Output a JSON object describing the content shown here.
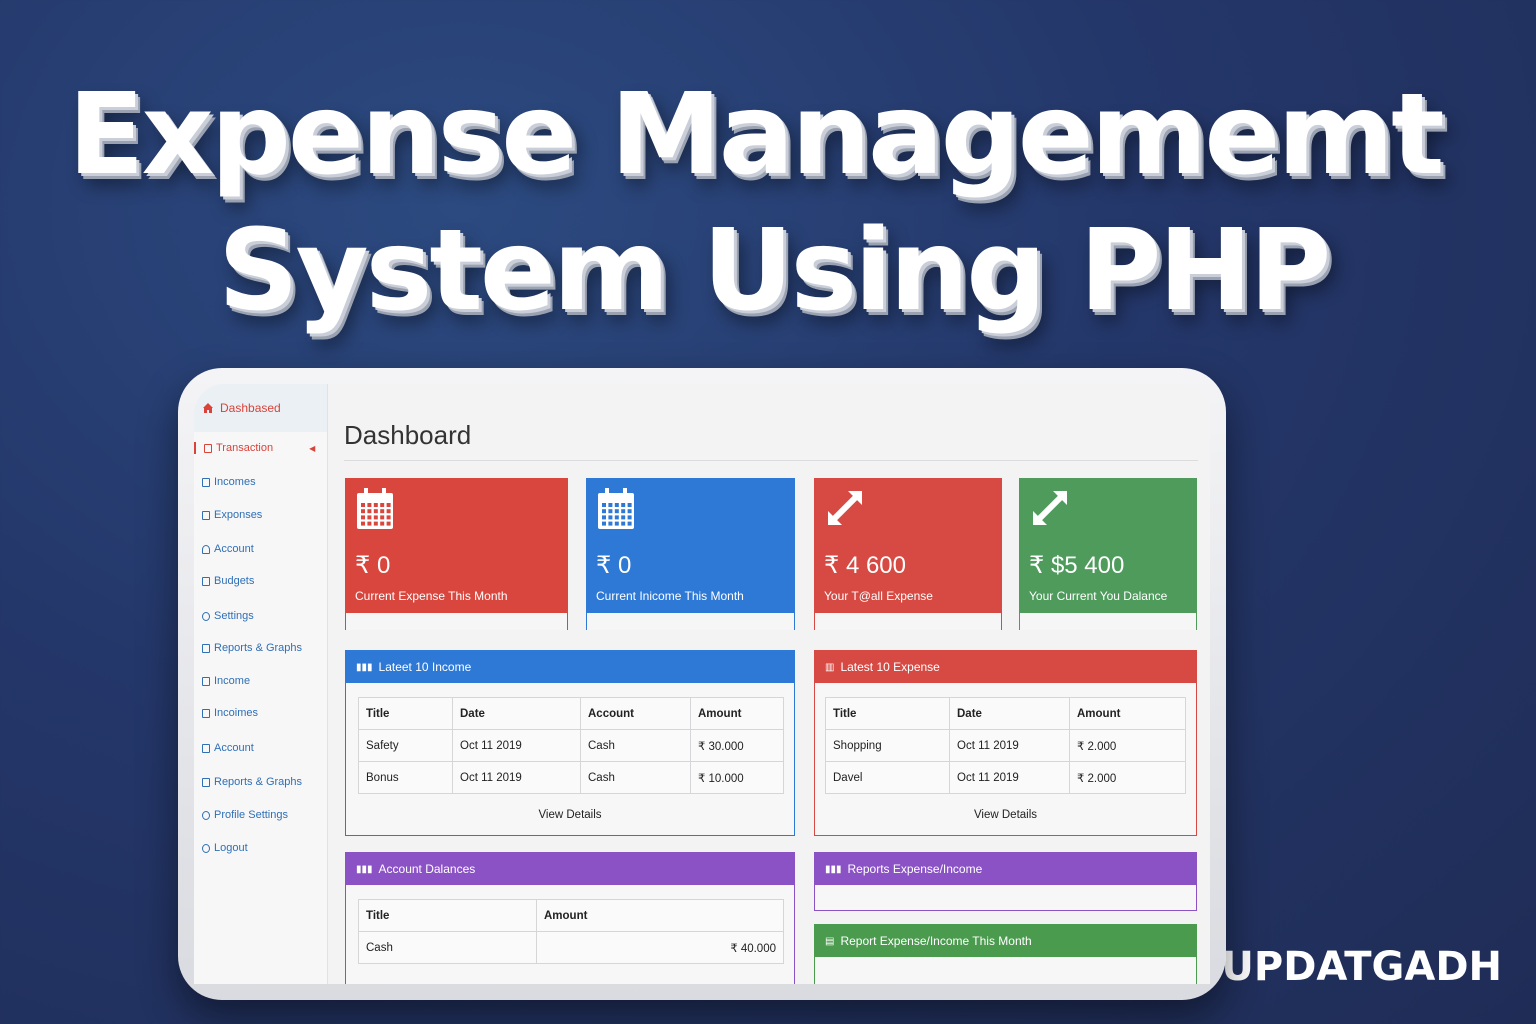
{
  "headline": {
    "line1": "Expense Managememt",
    "line2": "System Using PHP"
  },
  "brand": "UPDATGADH",
  "sidebar": {
    "top": {
      "label": "Dashbased",
      "icon": "home-icon"
    },
    "items": [
      {
        "label": "Transaction",
        "icon": "wallet-icon",
        "active": true
      },
      {
        "label": "Incomes",
        "icon": "document-icon"
      },
      {
        "label": "Exponses",
        "icon": "document-icon"
      },
      {
        "label": "Account",
        "icon": "user-icon"
      },
      {
        "label": "Budgets",
        "icon": "book-icon"
      },
      {
        "label": "Settings",
        "icon": "gear-icon"
      },
      {
        "label": "Reports & Graphs",
        "icon": "chart-icon"
      },
      {
        "label": "Income",
        "icon": "document-icon"
      },
      {
        "label": "Incoimes",
        "icon": "list-icon"
      },
      {
        "label": "Account",
        "icon": "document-icon"
      },
      {
        "label": "Reports & Graphs",
        "icon": "chart-icon"
      },
      {
        "label": "Profile Settings",
        "icon": "user-gear-icon"
      },
      {
        "label": "Logout",
        "icon": "logout-icon"
      }
    ]
  },
  "main": {
    "title": "Dashboard",
    "stats": [
      {
        "value": "₹ 0",
        "label": "Current Expense This Month",
        "color": "#d9463d",
        "icon": "calendar-icon"
      },
      {
        "value": "₹ 0",
        "label": "Current Inicome This Month",
        "color": "#2f79d6",
        "icon": "calendar-icon"
      },
      {
        "value": "₹ 4 600",
        "label": "Your T@all Expense",
        "color": "#d64a43",
        "icon": "arrows-expand-icon"
      },
      {
        "value": "₹ $5 400",
        "label": "Your Current  You Dalance",
        "color": "#4e9b5c",
        "icon": "arrows-expand-icon"
      }
    ],
    "income_panel": {
      "title": "Lateet 10  Income",
      "color": "#2f79d6",
      "headers": [
        "Title",
        "Date",
        "Account",
        "Amount"
      ],
      "rows": [
        [
          "Safety",
          "Oct 11 2019",
          "Cash",
          "₹ 30.000"
        ],
        [
          "Bonus",
          "Oct 11 2019",
          "Cash",
          "₹ 10.000"
        ]
      ],
      "link": "View Details"
    },
    "expense_panel": {
      "title": "Latest 10 Expense",
      "color": "#d64a43",
      "headers": [
        "Title",
        "Date",
        "Amount"
      ],
      "rows": [
        [
          "Shopping",
          "Oct 11 2019",
          "₹ 2.000"
        ],
        [
          "Davel",
          "Oct 11 2019",
          "₹ 2.000"
        ]
      ],
      "link": "View Details"
    },
    "balances_panel": {
      "title": "Account Dalances",
      "color": "#8a52c4",
      "headers": [
        "Title",
        "Amount"
      ],
      "rows": [
        [
          "Cash",
          "₹ 40.000"
        ]
      ]
    },
    "reports_panel": {
      "title": "Reports Expense/Income",
      "color": "#8a52c4"
    },
    "report_month_panel": {
      "title": "Report Expense/Income This Month",
      "color": "#4b9b4f"
    }
  }
}
